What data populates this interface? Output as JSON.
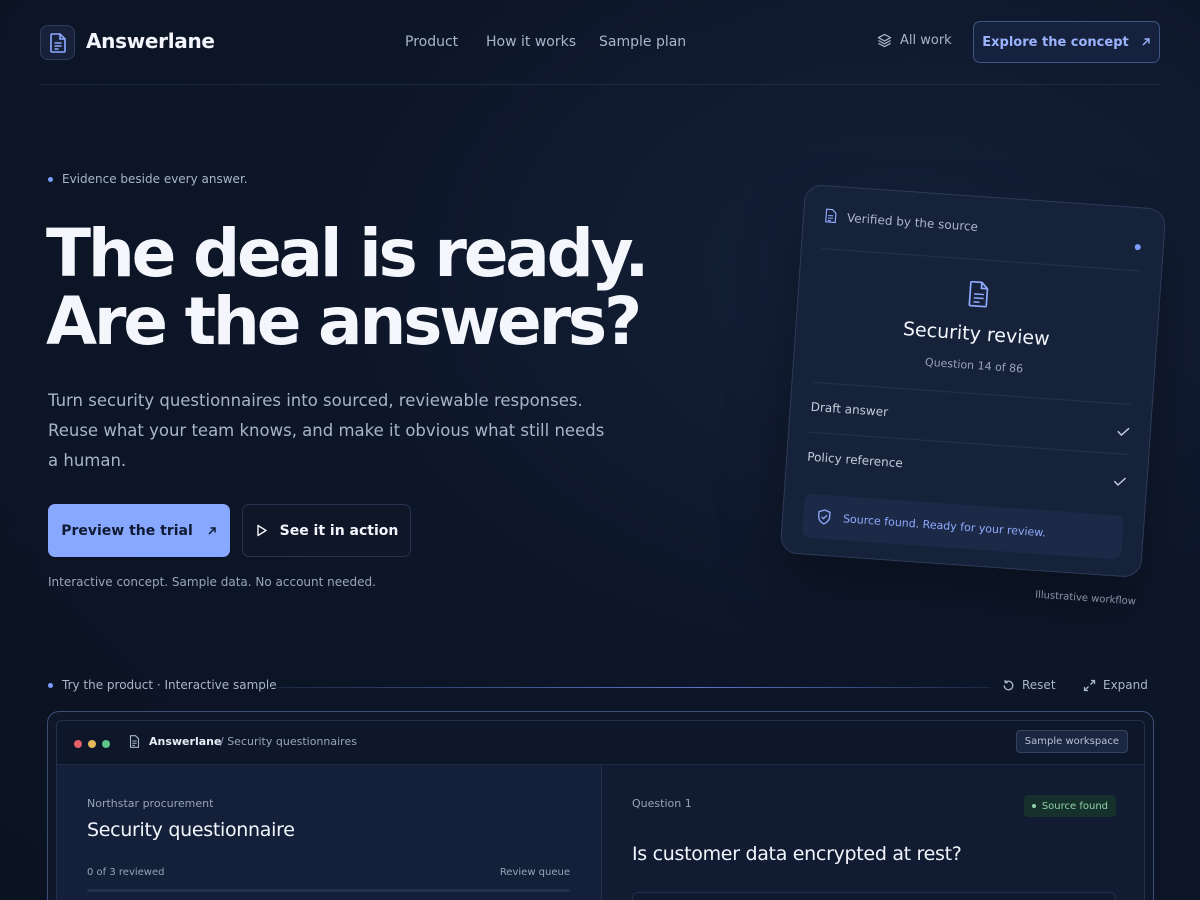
{
  "header": {
    "brand": "Answerlane",
    "nav": [
      "Product",
      "How it works",
      "Sample plan"
    ],
    "all_work": "All work",
    "cta": "Explore the concept"
  },
  "hero": {
    "eyebrow": "Evidence beside every answer.",
    "headline_line1": "The deal is ready.",
    "headline_line2": "Are the answers?",
    "lede": "Turn security questionnaires into sourced, reviewable responses. Reuse what your team knows, and make it obvious what still needs a human.",
    "primary_button": "Preview the trial",
    "secondary_button": "See it in action",
    "fineprint": "Interactive concept. Sample data. No account needed."
  },
  "card": {
    "header": "Verified by the source",
    "title": "Security review",
    "subtitle": "Question 14 of 86",
    "rows": [
      "Draft answer",
      "Policy reference"
    ],
    "banner": "Source found. Ready for your review.",
    "caption": "Illustrative workflow"
  },
  "trybar": {
    "label": "Try the product · Interactive sample",
    "reset": "Reset",
    "expand": "Expand"
  },
  "app": {
    "name": "Answerlane",
    "path": "/ Security questionnaires",
    "workspace_badge": "Sample workspace",
    "left": {
      "org": "Northstar procurement",
      "title": "Security questionnaire",
      "progress": "0 of 3 reviewed",
      "queue": "Review queue"
    },
    "right": {
      "question_label": "Question 1",
      "status_badge": "Source found",
      "question": "Is customer data encrypted at rest?"
    }
  },
  "colors": {
    "accent": "#88a8ff",
    "background": "#0d1628",
    "success": "#8fd3a8"
  }
}
